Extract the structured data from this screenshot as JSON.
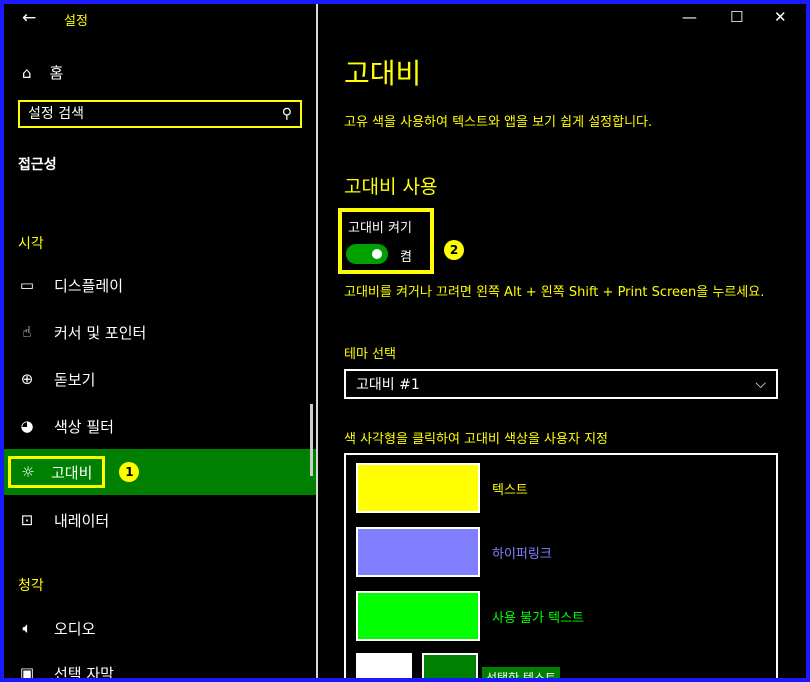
{
  "window": {
    "title": "설정",
    "back_glyph": "←",
    "minimize": "—",
    "maximize": "☐",
    "close": "✕"
  },
  "sidebar": {
    "home_label": "홈",
    "search_placeholder": "설정 검색",
    "section_title": "접근성",
    "groups": [
      {
        "label": "시각"
      },
      {
        "label": "청각"
      }
    ],
    "items": [
      {
        "label": "디스플레이",
        "icon": "monitor-icon"
      },
      {
        "label": "커서 및 포인터",
        "icon": "cursor-icon"
      },
      {
        "label": "돋보기",
        "icon": "magnifier-icon"
      },
      {
        "label": "색상 필터",
        "icon": "palette-icon"
      },
      {
        "label": "고대비",
        "icon": "sun-icon",
        "active": true,
        "badge": "1"
      },
      {
        "label": "내레이터",
        "icon": "narrator-icon"
      },
      {
        "label": "오디오",
        "icon": "speaker-icon"
      },
      {
        "label": "선택 자막",
        "icon": "caption-icon"
      }
    ]
  },
  "main": {
    "title": "고대비",
    "description": "고유 색을 사용하여 텍스트와 앱을 보기 쉽게 설정합니다.",
    "section": "고대비 사용",
    "toggle_label": "고대비 켜기",
    "toggle_state": "켬",
    "toggle_on": true,
    "badge": "2",
    "hint": "고대비를 켜거나 끄려면 왼쪽 Alt + 왼쪽 Shift + Print Screen을 누르세요.",
    "theme_label": "테마 선택",
    "theme_value": "고대비 #1",
    "customize_label": "색 사각형을 클릭하여 고대비 색상을 사용자 지정",
    "swatches": [
      {
        "label": "텍스트",
        "color": "#ffff00",
        "label_color": "#ffff00"
      },
      {
        "label": "하이퍼링크",
        "color": "#8080ff",
        "label_color": "#8080ff"
      },
      {
        "label": "사용 불가 텍스트",
        "color": "#00ff00",
        "label_color": "#00ff00"
      }
    ],
    "selected_text": {
      "label": "선택한 텍스트",
      "fg": "#ffffff",
      "bg": "#008000"
    }
  },
  "colors": {
    "accent": "#ffff00",
    "active_bg": "#008000",
    "border": "#1a1aff"
  }
}
